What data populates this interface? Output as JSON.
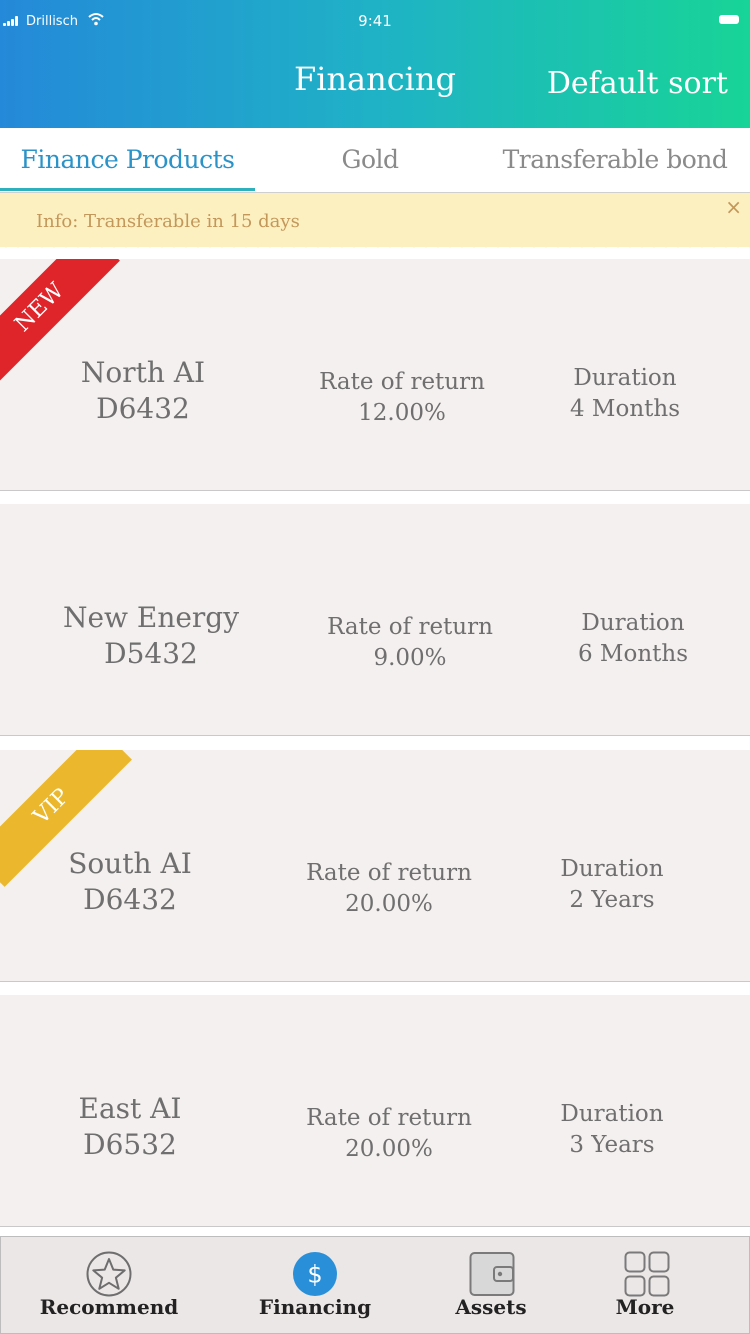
{
  "status_bar": {
    "carrier": "Drillisch",
    "time": "9:41"
  },
  "header": {
    "title": "Financing",
    "sort_label": "Default sort"
  },
  "tabs": [
    {
      "label": "Finance Products",
      "active": true
    },
    {
      "label": "Gold",
      "active": false
    },
    {
      "label": "Transferable bond",
      "active": false
    }
  ],
  "info": {
    "text": "Info: Transferable in 15 days",
    "close_symbol": "×"
  },
  "products": [
    {
      "name_line1": "North AI",
      "name_line2": "D6432",
      "rate_label": "Rate of return",
      "rate": "12.00%",
      "duration_label": "Duration",
      "duration": "4 Months",
      "badge": "NEW",
      "badge_color": "#e0252a"
    },
    {
      "name_line1": "New Energy",
      "name_line2": "D5432",
      "rate_label": "Rate of return",
      "rate": "9.00%",
      "duration_label": "Duration",
      "duration": "6 Months",
      "badge": "",
      "badge_color": ""
    },
    {
      "name_line1": "South AI",
      "name_line2": "D6432",
      "rate_label": "Rate of return",
      "rate": "20.00%",
      "duration_label": "Duration",
      "duration": "2 Years",
      "badge": "VIP",
      "badge_color": "#ebb72c"
    },
    {
      "name_line1": "East AI",
      "name_line2": "D6532",
      "rate_label": "Rate of return",
      "rate": "20.00%",
      "duration_label": "Duration",
      "duration": "3 Years",
      "badge": "",
      "badge_color": ""
    }
  ],
  "tabbar": [
    {
      "label": "Recommend",
      "icon": "star-icon",
      "active": false
    },
    {
      "label": "Financing",
      "icon": "dollar-icon",
      "active": true
    },
    {
      "label": "Assets",
      "icon": "wallet-icon",
      "active": false
    },
    {
      "label": "More",
      "icon": "grid-icon",
      "active": false
    }
  ],
  "colors": {
    "accent": "#2b93c8",
    "card_bg": "#f4f0ef",
    "info_bg": "#fcefc0",
    "info_text": "#c3975a"
  }
}
